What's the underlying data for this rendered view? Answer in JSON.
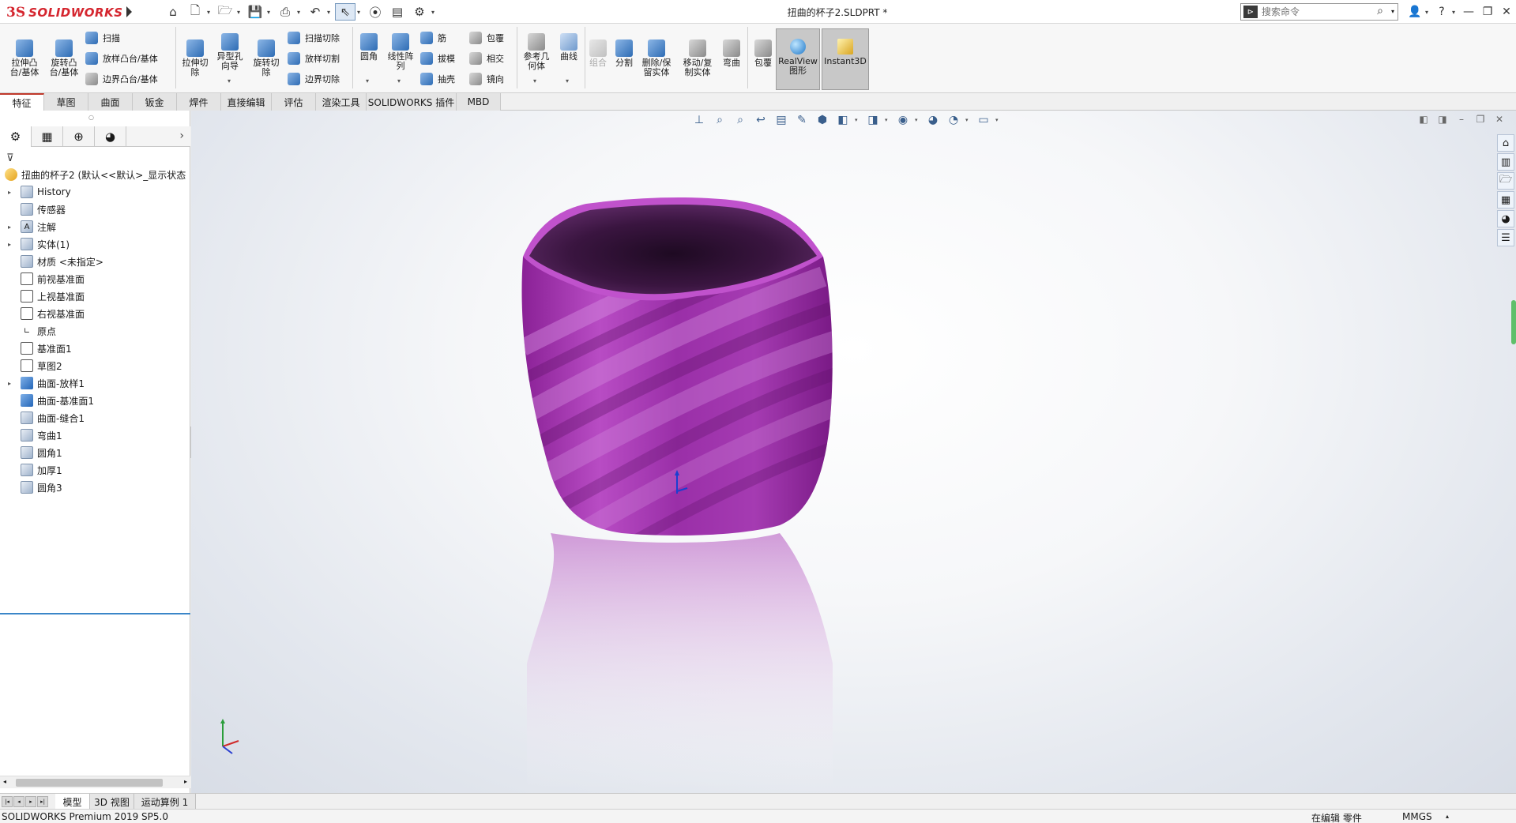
{
  "app": {
    "logo_ds": "3S",
    "logo_text": "SOLIDWORKS",
    "document_title": "扭曲的杯子2.SLDPRT *",
    "brand_color": "#d5262f"
  },
  "search": {
    "placeholder": "搜索命令"
  },
  "toolbar": {
    "extrude_boss": "拉伸凸\n台/基体",
    "revolve_boss": "旋转凸\n台/基体",
    "sweep": "扫描",
    "loft_boss": "放样凸台/基体",
    "boundary_boss": "边界凸台/基体",
    "extrude_cut": "拉伸切\n除",
    "hole_wizard": "异型孔\n向导",
    "revolve_cut": "旋转切\n除",
    "swept_cut": "扫描切除",
    "lofted_cut": "放样切割",
    "boundary_cut": "边界切除",
    "fillet": "圆角",
    "linear_pattern": "线性阵\n列",
    "rib": "筋",
    "draft": "拔模",
    "shell": "抽壳",
    "wrap": "包覆",
    "intersect": "相交",
    "mirror": "镜向",
    "ref_geometry": "参考几\n何体",
    "curves": "曲线",
    "combine": "组合",
    "split": "分割",
    "delete_keep_body": "删除/保\n留实体",
    "move_copy_body": "移动/复\n制实体",
    "flex": "弯曲",
    "wrap2": "包覆",
    "realview": "RealView\n图形",
    "instant3d": "Instant3D"
  },
  "tabs": [
    "特征",
    "草图",
    "曲面",
    "钣金",
    "焊件",
    "直接编辑",
    "评估",
    "渲染工具",
    "SOLIDWORKS 插件",
    "MBD"
  ],
  "tree": {
    "root": "扭曲的杯子2 (默认<<默认>_显示状态",
    "items": [
      {
        "label": "History",
        "expandable": true,
        "icon": "history-icon"
      },
      {
        "label": "传感器",
        "expandable": false,
        "icon": "sensor-icon"
      },
      {
        "label": "注解",
        "expandable": true,
        "icon": "annotation-icon"
      },
      {
        "label": "实体(1)",
        "expandable": true,
        "icon": "solid-bodies-icon"
      },
      {
        "label": "材质 <未指定>",
        "expandable": false,
        "icon": "material-icon"
      },
      {
        "label": "前视基准面",
        "expandable": false,
        "icon": "plane-icon"
      },
      {
        "label": "上视基准面",
        "expandable": false,
        "icon": "plane-icon"
      },
      {
        "label": "右视基准面",
        "expandable": false,
        "icon": "plane-icon"
      },
      {
        "label": "原点",
        "expandable": false,
        "icon": "origin-icon"
      },
      {
        "label": "基准面1",
        "expandable": false,
        "icon": "plane-icon"
      },
      {
        "label": "草图2",
        "expandable": false,
        "icon": "sketch-icon"
      },
      {
        "label": "曲面-放样1",
        "expandable": true,
        "icon": "surface-loft-icon"
      },
      {
        "label": "曲面-基准面1",
        "expandable": false,
        "icon": "planar-surface-icon"
      },
      {
        "label": "曲面-缝合1",
        "expandable": false,
        "icon": "knit-surface-icon"
      },
      {
        "label": "弯曲1",
        "expandable": false,
        "icon": "flex-icon"
      },
      {
        "label": "圆角1",
        "expandable": false,
        "icon": "fillet-icon"
      },
      {
        "label": "加厚1",
        "expandable": false,
        "icon": "thicken-icon"
      },
      {
        "label": "圆角3",
        "expandable": false,
        "icon": "fillet-icon"
      }
    ]
  },
  "bottom_tabs": [
    "模型",
    "3D 视图",
    "运动算例 1"
  ],
  "status": {
    "version": "SOLIDWORKS Premium 2019 SP5.0",
    "mode": "在编辑 零件",
    "units": "MMGS"
  },
  "model": {
    "color": "#a02dab"
  }
}
